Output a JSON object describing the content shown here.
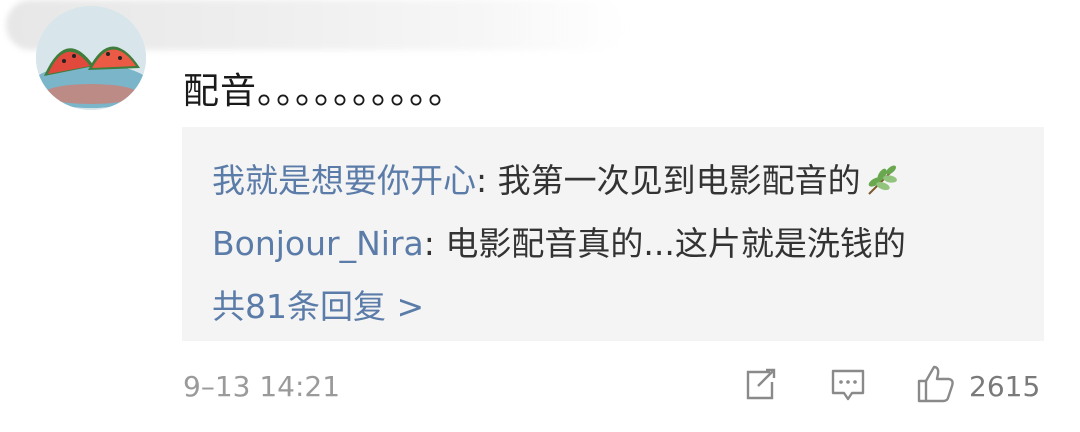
{
  "comment": {
    "text": "配音。。。。。。。。。。"
  },
  "replies": [
    {
      "user": "我就是想要你开心",
      "separator": ": ",
      "text": "我第一次见到电影配音的",
      "emoji_icon": "leaf-emoji-icon"
    },
    {
      "user": "Bonjour_Nira",
      "separator": ": ",
      "text": "电影配音真的...这片就是洗钱的"
    }
  ],
  "more_replies_label": "共81条回复 >",
  "meta": {
    "time": "9–13 14:21",
    "like_count": "2615"
  },
  "icons": {
    "share": "share-edit-icon",
    "comment": "comment-icon",
    "like": "thumbs-up-icon"
  },
  "colors": {
    "username": "#5b7ca8",
    "reply_bg": "#f4f4f4",
    "meta_gray": "#9a9a9a"
  }
}
